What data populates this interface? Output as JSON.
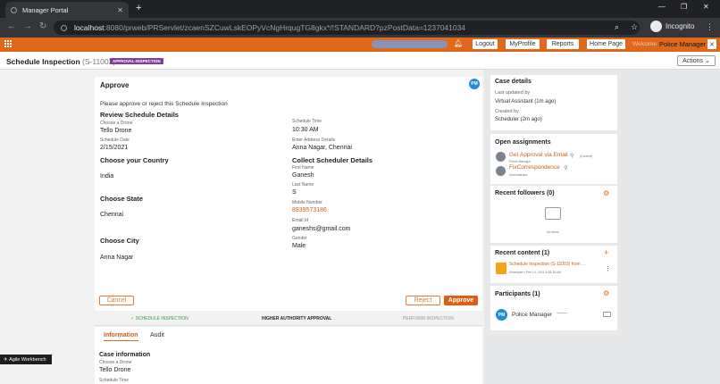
{
  "browser": {
    "tab_title": "Manager Portal",
    "url_host": "localhost",
    "url_rest": ":8080/prweb/PRServlet/zcaenSZCuwLskEOPyVcNgHrqugTG8gkx*/!STANDARD?pzPostData=1237041034",
    "profile_label": "Incognito"
  },
  "header": {
    "buttons": [
      "Logout",
      "MyProfile",
      "Reports",
      "Home Page"
    ],
    "welcome": "Welcome",
    "user": "Police Manager"
  },
  "case": {
    "title": "Schedule Inspection",
    "id": "(S-11003)",
    "status": "APPROVAL-INSPECTION",
    "actions_label": "Actions"
  },
  "approve": {
    "heading": "Approve",
    "avatar": "PM",
    "instruction": "Please approve or reject this Schedule Inspection",
    "review_heading": "Review Schedule Details",
    "drone_label": "Choose a Drone",
    "drone_value": "Tello Drone",
    "date_label": "Schedule Date",
    "date_value": "2/15/2021",
    "time_label": "Schedule Time",
    "time_value": "10:30 AM",
    "address_label": "Enter Address Details",
    "address_value": "Anna Nagar, Chennai",
    "country_heading": "Choose your Country",
    "country_value": "India",
    "state_heading": "Choose State",
    "state_value": "Chennai",
    "city_heading": "Choose City",
    "city_value": "Anna Nagar",
    "scheduler_heading": "Collect Scheduler Details",
    "first_name_label": "First Name",
    "first_name_value": "Ganesh",
    "last_name_label": "Last Name",
    "last_name_value": "S",
    "mobile_label": "Mobile Number",
    "mobile_value": "8939573186",
    "email_label": "Email Id",
    "email_value": "ganeshs@gmail.com",
    "gender_label": "Gender",
    "gender_value": "Male",
    "cancel_label": "Cancel",
    "reject_label": "Reject",
    "approve_label": "Approve"
  },
  "stages": {
    "s1": "SCHEDULE INSPECTION",
    "s2": "HIGHER AUTHORITY APPROVAL",
    "s3": "PERFORM INSPECTION"
  },
  "tabs": {
    "t1": "Information",
    "t2": "Audit",
    "case_info_heading": "Case information",
    "drone_label": "Choose a Drone",
    "drone_value": "Tello Drone",
    "time_label": "Schedule Time"
  },
  "workbench_label": "Agile Workbench",
  "right": {
    "case_details": {
      "heading": "Case details",
      "updated_label": "Last updated by",
      "updated_value": "Virtual Assistant (1m ago)",
      "created_label": "Created by",
      "created_value": "Scheduler (2m ago)"
    },
    "open_assignments": {
      "heading": "Open assignments",
      "a1_title": "Get Approval via Email",
      "a1_sub": "Police Manager",
      "a1_tag": "(Current)",
      "a2_title": "FixCorrespondence",
      "a2_sub": "Administrator"
    },
    "followers": {
      "heading": "Recent followers",
      "count": "(0)",
      "empty": "No items"
    },
    "recent_content": {
      "heading": "Recent content",
      "count": "(1)",
      "item_title": "Schedule Inspection (S-11003) from ...",
      "item_sub": "Scheduler  •  Feb 14, 2021 8:38:18 AM"
    },
    "participants": {
      "heading": "Participants",
      "count": "(1)",
      "avatar": "PM",
      "name": "Police Manager",
      "dash": "——"
    }
  }
}
